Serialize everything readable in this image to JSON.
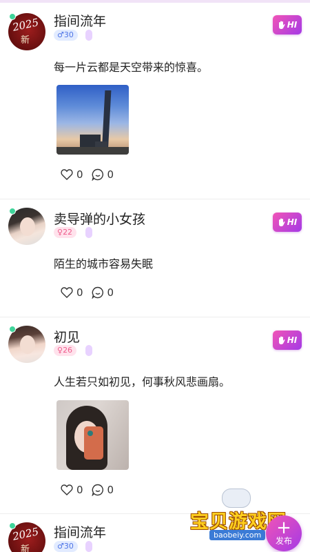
{
  "posts": [
    {
      "username": "指间流年",
      "gender": "male",
      "gender_symbol": "♂",
      "age": "30",
      "content": "每一片云都是天空带来的惊喜。",
      "likes": "0",
      "comments": "0",
      "hi_label": "HI"
    },
    {
      "username": "卖导弹的小女孩",
      "gender": "female",
      "gender_symbol": "♀",
      "age": "22",
      "content": "陌生的城市容易失眠",
      "likes": "0",
      "comments": "0",
      "hi_label": "HI"
    },
    {
      "username": "初见",
      "gender": "female",
      "gender_symbol": "♀",
      "age": "26",
      "content": "人生若只如初见，何事秋风悲画扇。",
      "likes": "0",
      "comments": "0",
      "hi_label": "HI"
    },
    {
      "username": "指间流年",
      "gender": "male",
      "gender_symbol": "♂",
      "age": "30",
      "hi_label": "HI"
    }
  ],
  "avatar_text": {
    "line1": "2025",
    "line2": "新"
  },
  "fab": {
    "plus": "+",
    "label": "发布"
  },
  "watermark": {
    "text": "宝贝游戏网",
    "url": "baobeiy.com"
  },
  "colors": {
    "accent_gradient_start": "#f154b6",
    "accent_gradient_end": "#a43ae6",
    "online": "#3fd49a",
    "male": "#4e74e6",
    "female": "#ee5c8c"
  }
}
